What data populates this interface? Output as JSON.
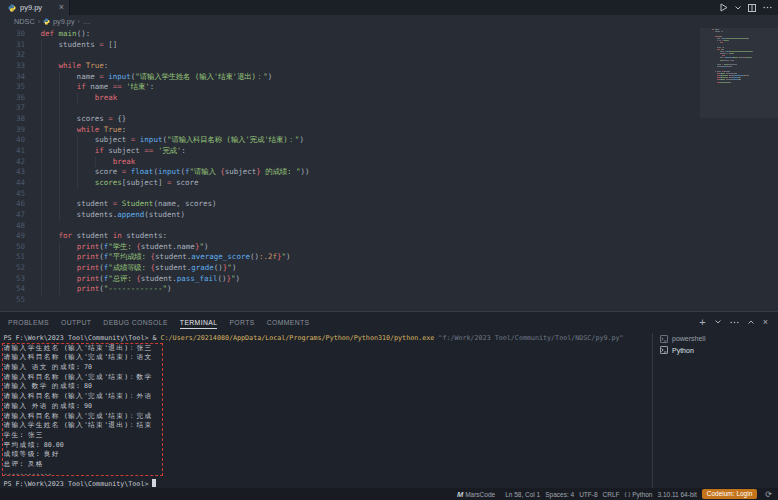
{
  "colors": {
    "editor_bg": "#272c35",
    "tabbar_bg": "#1b1f26",
    "panel_bg": "#1e222a",
    "statusbar_bg": "#181c22",
    "keyword": "#e06c75",
    "string": "#98c379",
    "function": "#61afef",
    "constant": "#d19a66",
    "definition": "#98c379",
    "operator": "#a75f66",
    "text": "#abb2bf",
    "line_number": "#4e5868",
    "annotation_box": "#d03a35",
    "command_exe": "#d9b664",
    "command_arg": "#6f7987",
    "codeium_badge_bg": "#c4741b"
  },
  "tab_bar": {
    "tab": {
      "label": "py9.py",
      "icon": "python-icon",
      "close": "×"
    },
    "actions": {
      "run": "run",
      "run_dropdown": "chevron-down",
      "split_editor": "split-editor",
      "more": "ellipsis"
    }
  },
  "breadcrumb": {
    "items": [
      "NDSC",
      "py9.py",
      "…"
    ],
    "separator": "›"
  },
  "editor": {
    "first_line_number": 30,
    "cursor_position": {
      "line": 58,
      "column": 1
    },
    "lines": [
      {
        "n": 30,
        "guides": 0,
        "tokens": [
          [
            "k",
            "def"
          ],
          [
            "t",
            " "
          ],
          [
            "g",
            "main"
          ],
          [
            "t",
            "():"
          ]
        ]
      },
      {
        "n": 31,
        "guides": 1,
        "tokens": [
          [
            "t",
            "    students "
          ],
          [
            "o",
            "="
          ],
          [
            "t",
            " []"
          ]
        ]
      },
      {
        "n": 32,
        "guides": 1,
        "tokens": []
      },
      {
        "n": 33,
        "guides": 1,
        "tokens": [
          [
            "t",
            "    "
          ],
          [
            "k",
            "while"
          ],
          [
            "t",
            " "
          ],
          [
            "n",
            "True"
          ],
          [
            "t",
            ":"
          ]
        ]
      },
      {
        "n": 34,
        "guides": 2,
        "tokens": [
          [
            "t",
            "        name "
          ],
          [
            "o",
            "="
          ],
          [
            "t",
            " "
          ],
          [
            "f",
            "input"
          ],
          [
            "t",
            "("
          ],
          [
            "s",
            "\"请输入学生姓名 (输入'结束'退出)：\""
          ],
          [
            "t",
            ")"
          ]
        ]
      },
      {
        "n": 35,
        "guides": 2,
        "tokens": [
          [
            "t",
            "        "
          ],
          [
            "k",
            "if"
          ],
          [
            "t",
            " name "
          ],
          [
            "o",
            "=="
          ],
          [
            "t",
            " "
          ],
          [
            "s",
            "'结束'"
          ],
          [
            "t",
            ":"
          ]
        ]
      },
      {
        "n": 36,
        "guides": 3,
        "tokens": [
          [
            "t",
            "            "
          ],
          [
            "k",
            "break"
          ]
        ]
      },
      {
        "n": 37,
        "guides": 2,
        "tokens": []
      },
      {
        "n": 38,
        "guides": 2,
        "tokens": [
          [
            "t",
            "        scores "
          ],
          [
            "o",
            "="
          ],
          [
            "t",
            " {}"
          ]
        ]
      },
      {
        "n": 39,
        "guides": 2,
        "tokens": [
          [
            "t",
            "        "
          ],
          [
            "k",
            "while"
          ],
          [
            "t",
            " "
          ],
          [
            "n",
            "True"
          ],
          [
            "t",
            ":"
          ]
        ]
      },
      {
        "n": 40,
        "guides": 3,
        "tokens": [
          [
            "t",
            "            subject "
          ],
          [
            "o",
            "="
          ],
          [
            "t",
            " "
          ],
          [
            "f",
            "input"
          ],
          [
            "t",
            "("
          ],
          [
            "s",
            "\"请输入科目名称 (输入'完成'结束)：\""
          ],
          [
            "t",
            ")"
          ]
        ]
      },
      {
        "n": 41,
        "guides": 3,
        "tokens": [
          [
            "t",
            "            "
          ],
          [
            "k",
            "if"
          ],
          [
            "t",
            " subject "
          ],
          [
            "o",
            "=="
          ],
          [
            "t",
            " "
          ],
          [
            "s",
            "'完成'"
          ],
          [
            "t",
            ":"
          ]
        ]
      },
      {
        "n": 42,
        "guides": 4,
        "tokens": [
          [
            "t",
            "                "
          ],
          [
            "k",
            "break"
          ]
        ]
      },
      {
        "n": 43,
        "guides": 3,
        "tokens": [
          [
            "t",
            "            score "
          ],
          [
            "o",
            "="
          ],
          [
            "t",
            " "
          ],
          [
            "f",
            "float"
          ],
          [
            "t",
            "("
          ],
          [
            "f",
            "input"
          ],
          [
            "t",
            "("
          ],
          [
            "f",
            "f"
          ],
          [
            "s",
            "\"请输入 "
          ],
          [
            "b",
            "{"
          ],
          [
            "t",
            "subject"
          ],
          [
            "b",
            "}"
          ],
          [
            "s",
            " 的成绩: \""
          ],
          [
            "t",
            "))"
          ]
        ]
      },
      {
        "n": 44,
        "guides": 3,
        "tokens": [
          [
            "t",
            "            "
          ],
          [
            "g",
            "scores"
          ],
          [
            "t",
            "[subject] "
          ],
          [
            "o",
            "="
          ],
          [
            "t",
            " score"
          ]
        ]
      },
      {
        "n": 45,
        "guides": 2,
        "tokens": []
      },
      {
        "n": 46,
        "guides": 2,
        "tokens": [
          [
            "t",
            "        student "
          ],
          [
            "o",
            "="
          ],
          [
            "t",
            " "
          ],
          [
            "g",
            "Student"
          ],
          [
            "t",
            "(name, scores)"
          ]
        ]
      },
      {
        "n": 47,
        "guides": 2,
        "tokens": [
          [
            "t",
            "        students."
          ],
          [
            "f",
            "append"
          ],
          [
            "t",
            "(student)"
          ]
        ]
      },
      {
        "n": 48,
        "guides": 1,
        "tokens": []
      },
      {
        "n": 49,
        "guides": 1,
        "tokens": [
          [
            "t",
            "    "
          ],
          [
            "k",
            "for"
          ],
          [
            "t",
            " student "
          ],
          [
            "k",
            "in"
          ],
          [
            "t",
            " students:"
          ]
        ]
      },
      {
        "n": 50,
        "guides": 2,
        "tokens": [
          [
            "t",
            "        "
          ],
          [
            "k",
            "print"
          ],
          [
            "t",
            "("
          ],
          [
            "f",
            "f"
          ],
          [
            "s",
            "\"学生: "
          ],
          [
            "b",
            "{"
          ],
          [
            "t",
            "student.name"
          ],
          [
            "b",
            "}"
          ],
          [
            "s",
            "\""
          ],
          [
            "t",
            ")"
          ]
        ]
      },
      {
        "n": 51,
        "guides": 2,
        "tokens": [
          [
            "t",
            "        "
          ],
          [
            "k",
            "print"
          ],
          [
            "t",
            "("
          ],
          [
            "f",
            "f"
          ],
          [
            "s",
            "\"平均成绩: "
          ],
          [
            "b",
            "{"
          ],
          [
            "t",
            "student."
          ],
          [
            "f",
            "average_score"
          ],
          [
            "t",
            "()"
          ],
          [
            "m",
            ":.2f"
          ],
          [
            "b",
            "}"
          ],
          [
            "s",
            "\""
          ],
          [
            "t",
            ")"
          ]
        ]
      },
      {
        "n": 52,
        "guides": 2,
        "tokens": [
          [
            "t",
            "        "
          ],
          [
            "k",
            "print"
          ],
          [
            "t",
            "("
          ],
          [
            "f",
            "f"
          ],
          [
            "s",
            "\"成绩等级: "
          ],
          [
            "b",
            "{"
          ],
          [
            "t",
            "student."
          ],
          [
            "f",
            "grade"
          ],
          [
            "t",
            "()"
          ],
          [
            "b",
            "}"
          ],
          [
            "s",
            "\""
          ],
          [
            "t",
            ")"
          ]
        ]
      },
      {
        "n": 53,
        "guides": 2,
        "tokens": [
          [
            "t",
            "        "
          ],
          [
            "k",
            "print"
          ],
          [
            "t",
            "("
          ],
          [
            "f",
            "f"
          ],
          [
            "s",
            "\"总评: "
          ],
          [
            "b",
            "{"
          ],
          [
            "t",
            "student."
          ],
          [
            "f",
            "pass_fail"
          ],
          [
            "t",
            "()"
          ],
          [
            "b",
            "}"
          ],
          [
            "s",
            "\""
          ],
          [
            "t",
            ")"
          ]
        ]
      },
      {
        "n": 54,
        "guides": 2,
        "tokens": [
          [
            "t",
            "        "
          ],
          [
            "k",
            "print"
          ],
          [
            "t",
            "("
          ],
          [
            "s",
            "\"------------\""
          ],
          [
            "t",
            ")"
          ]
        ]
      },
      {
        "n": 55,
        "guides": 0,
        "tokens": []
      }
    ]
  },
  "panel": {
    "tabs": [
      {
        "label": "PROBLEMS",
        "active": false
      },
      {
        "label": "OUTPUT",
        "active": false
      },
      {
        "label": "DEBUG CONSOLE",
        "active": false
      },
      {
        "label": "TERMINAL",
        "active": true
      },
      {
        "label": "PORTS",
        "active": false
      },
      {
        "label": "COMMENTS",
        "active": false
      }
    ],
    "actions": {
      "new_terminal": "+",
      "dropdown": "chevron-down",
      "more": "⋯",
      "maximize": "chevron-up",
      "close": "×"
    },
    "terminal": {
      "lines": [
        {
          "segments": [
            [
              "d",
              "PS F:\\Work\\2023 Tool\\Community\\Tool> & "
            ],
            [
              "y",
              "C:/Users/20214080/AppData/Local/Programs/Python/Python310/python.exe"
            ],
            [
              "d",
              " "
            ],
            [
              "q",
              "\"f:/Work/2023 Tool/Community/Tool/NDSC/py9.py\""
            ]
          ]
        },
        {
          "segments": [
            [
              "d",
              "请输入学生姓名 (输入'结束'退出)：张三"
            ]
          ]
        },
        {
          "segments": [
            [
              "d",
              "请输入科目名称 (输入'完成'结束)：语文"
            ]
          ]
        },
        {
          "segments": [
            [
              "d",
              "请输入 语文 的成绩: 70"
            ]
          ]
        },
        {
          "segments": [
            [
              "d",
              "请输入科目名称 (输入'完成'结束)：数学"
            ]
          ]
        },
        {
          "segments": [
            [
              "d",
              "请输入 数学 的成绩: 80"
            ]
          ]
        },
        {
          "segments": [
            [
              "d",
              "请输入科目名称 (输入'完成'结束)：外语"
            ]
          ]
        },
        {
          "segments": [
            [
              "d",
              "请输入 外语 的成绩: 90"
            ]
          ]
        },
        {
          "segments": [
            [
              "d",
              "请输入科目名称 (输入'完成'结束)：完成"
            ]
          ]
        },
        {
          "segments": [
            [
              "d",
              "请输入学生姓名 (输入'结束'退出)：结束"
            ]
          ]
        },
        {
          "segments": [
            [
              "d",
              "学生: 张三"
            ]
          ]
        },
        {
          "segments": [
            [
              "d",
              "平均成绩: 80.00"
            ]
          ]
        },
        {
          "segments": [
            [
              "d",
              "成绩等级: 良好"
            ]
          ]
        },
        {
          "segments": [
            [
              "d",
              "总评: 及格"
            ]
          ]
        },
        {
          "segments": [
            [
              "d",
              "------------"
            ]
          ]
        },
        {
          "segments": [
            [
              "d",
              "PS F:\\Work\\2023 Tool\\Community\\Tool> "
            ]
          ],
          "cursor": true
        }
      ],
      "annotation_box": true
    },
    "sessions": [
      {
        "icon": "terminal-icon",
        "label": "powershell",
        "active": false
      },
      {
        "icon": "terminal-icon",
        "label": "Python",
        "active": true
      }
    ]
  },
  "status_bar": {
    "items": {
      "marscode": "MarsCode",
      "cursor": "Ln 58, Col 1",
      "indent": "Spaces: 4",
      "encoding": "UTF-8",
      "eol": "CRLF",
      "language": "Python",
      "interpreter": "3.10.11 64-bit",
      "codeium": "Codeium: Login"
    }
  }
}
